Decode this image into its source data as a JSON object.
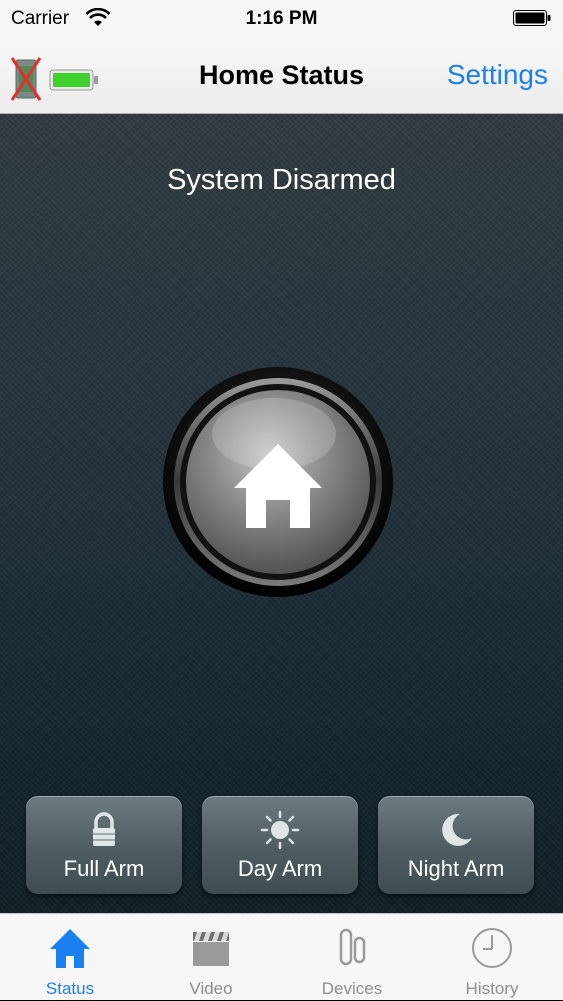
{
  "status_bar": {
    "carrier": "Carrier",
    "time": "1:16 PM",
    "icons": [
      "wifi-icon",
      "battery-icon"
    ]
  },
  "nav": {
    "title": "Home Status",
    "settings_label": "Settings",
    "icons": [
      "connection-disabled-icon",
      "panel-battery-icon"
    ]
  },
  "main": {
    "status_text": "System Disarmed",
    "arm_button_icon": "home-icon",
    "modes": [
      {
        "label": "Full Arm",
        "icon": "lock-icon"
      },
      {
        "label": "Day Arm",
        "icon": "sun-icon"
      },
      {
        "label": "Night Arm",
        "icon": "moon-icon"
      }
    ]
  },
  "tabs": [
    {
      "label": "Status",
      "icon": "home-icon",
      "active": true
    },
    {
      "label": "Video",
      "icon": "clapperboard-icon",
      "active": false
    },
    {
      "label": "Devices",
      "icon": "sensor-icon",
      "active": false
    },
    {
      "label": "History",
      "icon": "clock-icon",
      "active": false
    }
  ],
  "colors": {
    "accent": "#1a7ff0",
    "tab_inactive": "#8e8e8e",
    "battery_green": "#3fd12b",
    "disabled_red": "#e03030"
  }
}
